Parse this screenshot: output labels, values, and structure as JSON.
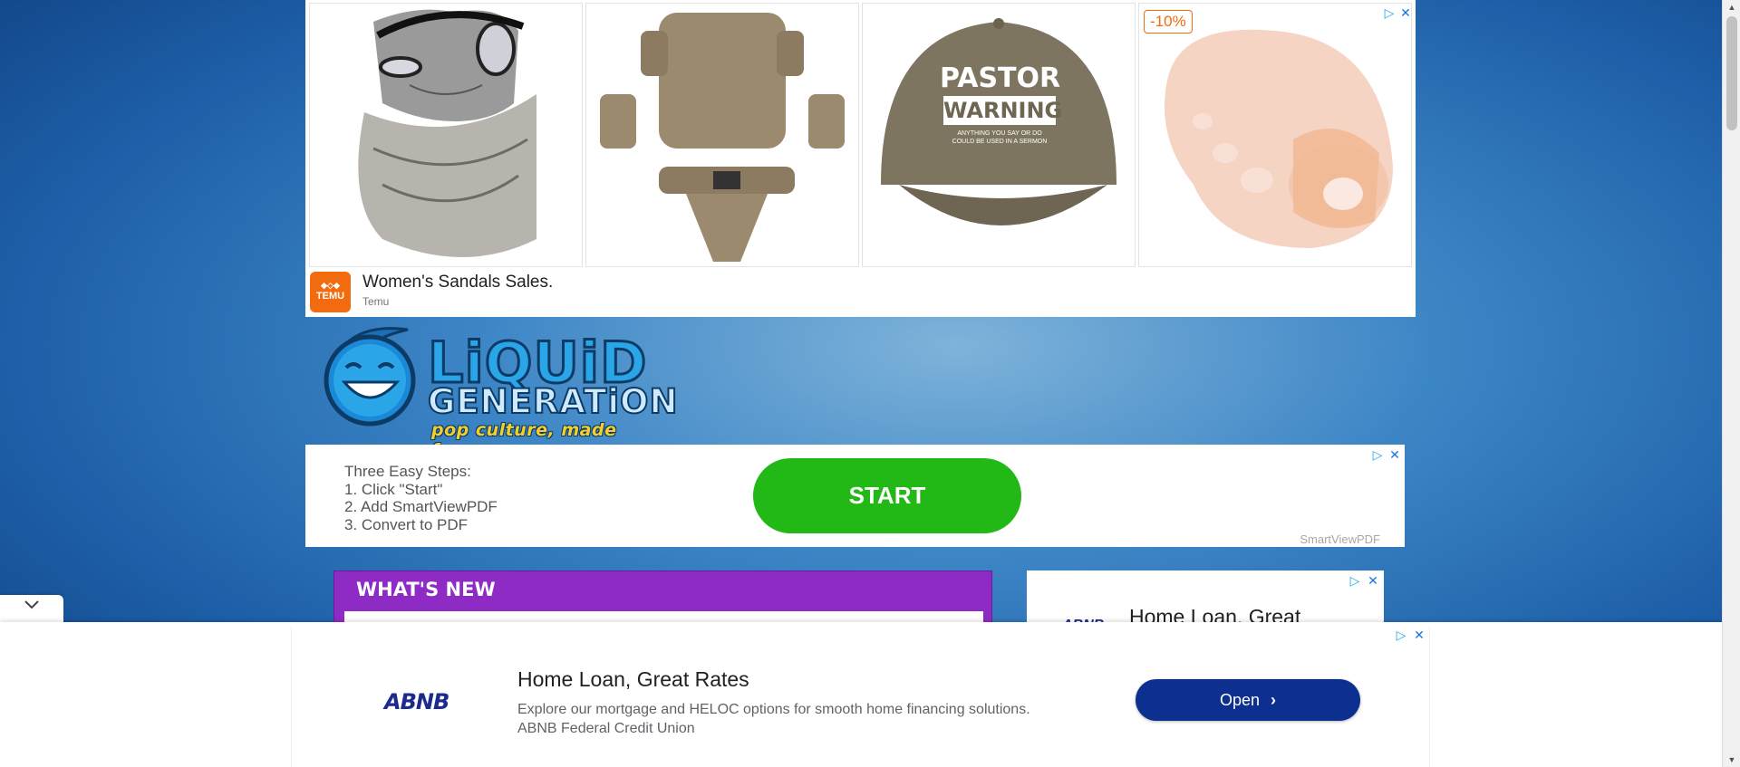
{
  "top_ad": {
    "discount_badge": "-10%",
    "headline": "Women's Sandals Sales.",
    "sponsor": "Temu",
    "brand_logo_text": "TEMU",
    "tiles": [
      {
        "name": "cat-face-mask",
        "caption": ""
      },
      {
        "name": "tactical-armor-set",
        "caption": ""
      },
      {
        "name": "pastor-warning-cap",
        "cap_line1": "PASTOR",
        "cap_line2": "WARNING",
        "cap_small1": "ANYTHING YOU SAY OR DO",
        "cap_small2": "COULD BE USED IN A SERMON"
      },
      {
        "name": "toe-separator",
        "caption": ""
      }
    ],
    "colors": {
      "brand": "#f26b0f",
      "adchoice": "#1aa7e6"
    }
  },
  "logo": {
    "word1": "LiQUiD",
    "word2": "GENERATiON",
    "tagline": "pop culture, made funny."
  },
  "mid_ad": {
    "steps": [
      "Three Easy Steps:",
      "1. Click \"Start\"",
      "2. Add SmartViewPDF",
      "3. Convert to PDF"
    ],
    "button_label": "START",
    "sponsor": "SmartViewPDF",
    "colors": {
      "button": "#22b816"
    }
  },
  "whats_new": {
    "title": "WHAT'S NEW",
    "colors": {
      "header": "#8e2bc4"
    }
  },
  "side_ad": {
    "headline": "Home Loan, Great",
    "logo_text": "ABNB"
  },
  "anchor_ad": {
    "logo_text": "ABNB",
    "headline": "Home Loan, Great Rates",
    "description_line1": "Explore our mortgage and HELOC options for smooth home financing solutions.",
    "description_line2": "ABNB Federal Credit Union",
    "button_label": "Open",
    "button_icon": "chevron-right-icon",
    "colors": {
      "button": "#0d2f8f"
    }
  },
  "collapse_toggle": {
    "icon": "chevron-down-icon"
  },
  "scrollbar": {
    "up_icon": "scroll-up-arrow",
    "down_icon": "scroll-down-arrow"
  }
}
